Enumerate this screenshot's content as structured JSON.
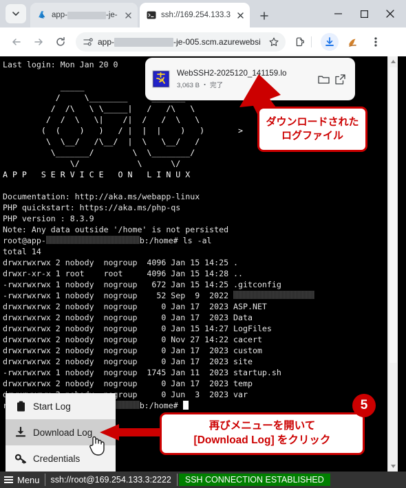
{
  "browser": {
    "tab_expander_icon": "chevron-down-icon",
    "tabs": [
      {
        "title_prefix": "app-",
        "title_suffix": "-je-",
        "favicon": "azure-logo-icon",
        "close_icon": "close-icon",
        "active": false
      },
      {
        "title": "ssh://169.254.133.3",
        "favicon": "terminal-icon",
        "close_icon": "close-icon",
        "active": true
      }
    ],
    "new_tab_label": "+",
    "window_controls": {
      "minimize": "–",
      "maximize": "□",
      "close": "✕"
    },
    "toolbar": {
      "back_icon": "back-arrow-icon",
      "forward_icon": "forward-arrow-icon",
      "reload_icon": "reload-icon",
      "site_info_icon": "tune-icon",
      "url_prefix": "app-",
      "url_suffix": "-je-005.scm.azurewebsi",
      "bookmark_icon": "star-outline-icon",
      "extensions_icon": "puzzle-piece-icon",
      "downloads_icon": "download-icon",
      "profile_icon": "profile-avatar-icon",
      "menu_icon": "three-dot-menu-icon"
    }
  },
  "download_popup": {
    "file_icon": "hidemaru-editor-icon",
    "filename": "WebSSH2-2025120_141159.lo",
    "meta": "3,063 B ・ 完了",
    "show_in_folder_icon": "folder-icon",
    "open_external_icon": "open-in-new-icon"
  },
  "terminal": {
    "lines": [
      "Last login: Mon Jan 20 0",
      "",
      "             _____",
      "            /      \\______       ______",
      "           /  /\\  \\ \\_____/     /  /\\  \\",
      "          /  /  \\  \\/    /|    /  /  \\  \\",
      "         (  (    )  )   / |   (  (    )  )      >",
      "          \\  \\__/  /\\__/  |    \\  \\__/  /",
      "           \\______/        \\    \\______/",
      "              \\/            \\      \\/",
      "A P P   S E R V I C E   O N   L I N U X"
    ],
    "banner_title": "A P P   S E R V I C E   O N   L I N U X",
    "info": [
      "Documentation: http://aka.ms/webapp-linux",
      "PHP quickstart: https://aka.ms/php-qs",
      "PHP version : 8.3.9",
      "Note: Any data outside '/home' is not persisted"
    ],
    "prompt1_user": "root@app-",
    "prompt1_host": "b:/home#",
    "prompt1_command": "ls -al",
    "total_line": "total 14",
    "listing": [
      {
        "perms": "drwxrwxrwx",
        "links": "2",
        "owner": "nobody",
        "group": "nogroup",
        "size": "4096",
        "month": "Jan",
        "day": "15",
        "time": "14:25",
        "name": ".",
        "redacted": false
      },
      {
        "perms": "drwxr-xr-x",
        "links": "1",
        "owner": "root",
        "group": "root",
        "size": "4096",
        "month": "Jan",
        "day": "15",
        "time": "14:28",
        "name": "..",
        "redacted": false
      },
      {
        "perms": "-rwxrwxrwx",
        "links": "1",
        "owner": "nobody",
        "group": "nogroup",
        "size": "672",
        "month": "Jan",
        "day": "15",
        "time": "14:25",
        "name": ".gitconfig",
        "redacted": false
      },
      {
        "perms": "-rwxrwxrwx",
        "links": "1",
        "owner": "nobody",
        "group": "nogroup",
        "size": "52",
        "month": "Sep",
        "day": "9",
        "time": "2022",
        "name": "",
        "redacted": true
      },
      {
        "perms": "drwxrwxrwx",
        "links": "2",
        "owner": "nobody",
        "group": "nogroup",
        "size": "0",
        "month": "Jan",
        "day": "17",
        "time": "2023",
        "name": "ASP.NET",
        "redacted": false
      },
      {
        "perms": "drwxrwxrwx",
        "links": "2",
        "owner": "nobody",
        "group": "nogroup",
        "size": "0",
        "month": "Jan",
        "day": "17",
        "time": "2023",
        "name": "Data",
        "redacted": false
      },
      {
        "perms": "drwxrwxrwx",
        "links": "2",
        "owner": "nobody",
        "group": "nogroup",
        "size": "0",
        "month": "Jan",
        "day": "15",
        "time": "14:27",
        "name": "LogFiles",
        "redacted": false
      },
      {
        "perms": "drwxrwxrwx",
        "links": "2",
        "owner": "nobody",
        "group": "nogroup",
        "size": "0",
        "month": "Nov",
        "day": "27",
        "time": "14:22",
        "name": "cacert",
        "redacted": false
      },
      {
        "perms": "drwxrwxrwx",
        "links": "2",
        "owner": "nobody",
        "group": "nogroup",
        "size": "0",
        "month": "Jan",
        "day": "17",
        "time": "2023",
        "name": "custom",
        "redacted": false
      },
      {
        "perms": "drwxrwxrwx",
        "links": "2",
        "owner": "nobody",
        "group": "nogroup",
        "size": "0",
        "month": "Jan",
        "day": "17",
        "time": "2023",
        "name": "site",
        "redacted": false
      },
      {
        "perms": "-rwxrwxrwx",
        "links": "1",
        "owner": "nobody",
        "group": "nogroup",
        "size": "1745",
        "month": "Jan",
        "day": "11",
        "time": "2023",
        "name": "startup.sh",
        "redacted": false
      },
      {
        "perms": "drwxrwxrwx",
        "links": "2",
        "owner": "nobody",
        "group": "nogroup",
        "size": "0",
        "month": "Jan",
        "day": "17",
        "time": "2023",
        "name": "temp",
        "redacted": false
      },
      {
        "perms": "drwxrwxrwx",
        "links": "2",
        "owner": "nobody",
        "group": "nogroup",
        "size": "0",
        "month": "Jun",
        "day": "3",
        "time": "2023",
        "name": "var",
        "redacted": false
      }
    ],
    "prompt2_user": "root@app-",
    "prompt2_host": "b:/home#"
  },
  "webssh_menu": {
    "items": [
      {
        "label": "Start Log",
        "icon": "clipboard-icon",
        "highlighted": false
      },
      {
        "label": "Download Log",
        "icon": "download-icon",
        "highlighted": true
      },
      {
        "label": "Credentials",
        "icon": "key-icon",
        "highlighted": false
      }
    ]
  },
  "status_bar": {
    "menu_label": "Menu",
    "menu_icon": "hamburger-icon",
    "url": "ssh://root@169.254.133.3:2222",
    "status": "SSH CONNECTION ESTABLISHED",
    "status_color": "#008000"
  },
  "annotations": {
    "callout1_line1": "ダウンロードされた",
    "callout1_line2": "ログファイル",
    "callout2_line1": "再びメニューを開いて",
    "callout2_line2": "[Download Log] をクリック",
    "step_badge": "5",
    "accent_color": "#cc0000"
  },
  "scrollbar": {
    "up_icon": "scroll-up-icon",
    "down_icon": "scroll-down-icon"
  }
}
